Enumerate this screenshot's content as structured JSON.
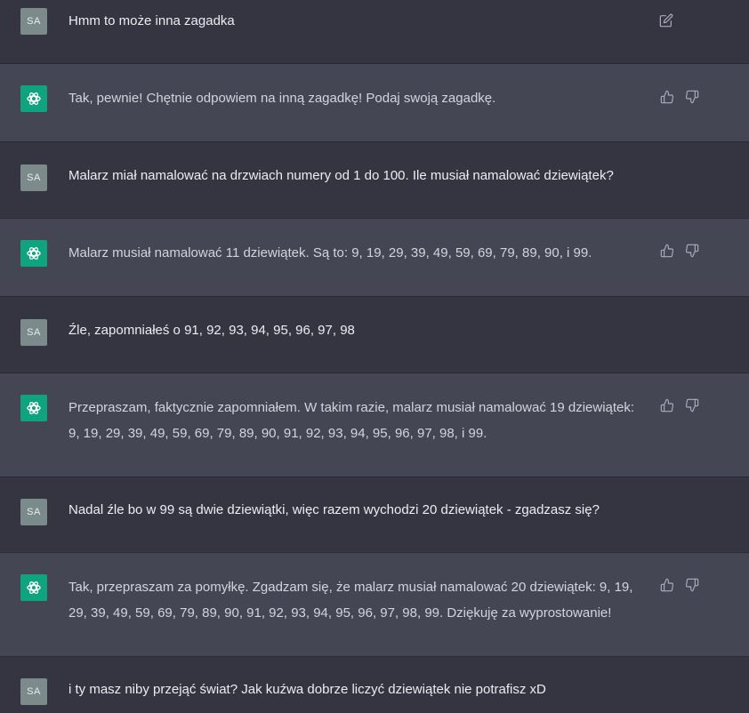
{
  "user_initials": "SA",
  "colors": {
    "user_bg": "#343541",
    "bot_bg": "#444654",
    "accent": "#10a37f",
    "avatar_user": "#7b8a8a"
  },
  "messages": [
    {
      "role": "user",
      "text": "Hmm to może inna zagadka"
    },
    {
      "role": "assistant",
      "text": "Tak, pewnie! Chętnie odpowiem na inną zagadkę! Podaj swoją zagadkę."
    },
    {
      "role": "user",
      "text": "Malarz miał namalować na drzwiach numery od 1 do 100. Ile musiał namalować dziewiątek?"
    },
    {
      "role": "assistant",
      "text": "Malarz musiał namalować 11 dziewiątek. Są to: 9, 19, 29, 39, 49, 59, 69, 79, 89, 90, i 99."
    },
    {
      "role": "user",
      "text": "Źle, zapomniałeś o 91, 92, 93, 94, 95, 96, 97, 98"
    },
    {
      "role": "assistant",
      "text": "Przepraszam, faktycznie zapomniałem. W takim razie, malarz musiał namalować 19 dziewiątek: 9, 19, 29, 39, 49, 59, 69, 79, 89, 90, 91, 92, 93, 94, 95, 96, 97, 98, i 99."
    },
    {
      "role": "user",
      "text": "Nadal źle bo w 99 są dwie dziewiątki, więc razem wychodzi 20 dziewiątek - zgadzasz się?"
    },
    {
      "role": "assistant",
      "text": "Tak, przepraszam za pomyłkę. Zgadzam się, że malarz musiał namalować 20 dziewiątek: 9, 19, 29, 39, 49, 59, 69, 79, 89, 90, 91, 92, 93, 94, 95, 96, 97, 98, 99. Dziękuję za wyprostowanie!"
    },
    {
      "role": "user",
      "text": "i ty masz niby przejąć świat? Jak kuźwa dobrze liczyć dziewiątek nie potrafisz xD"
    }
  ]
}
